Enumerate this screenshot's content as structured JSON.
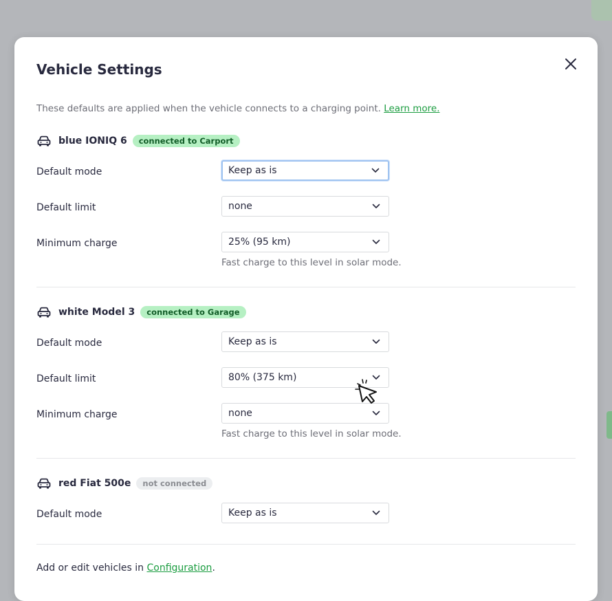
{
  "dialog": {
    "title": "Vehicle Settings",
    "intro_text": "These defaults are applied when the vehicle connects to a charging point. ",
    "intro_link": "Learn more."
  },
  "labels": {
    "default_mode": "Default mode",
    "default_limit": "Default limit",
    "minimum_charge": "Minimum charge",
    "min_charge_help": "Fast charge to this level in solar mode."
  },
  "vehicles": [
    {
      "name": "blue IONIQ 6",
      "status": "connected to Carport",
      "default_mode": "Keep as is",
      "default_limit": "none",
      "minimum_charge": "25% (95 km)"
    },
    {
      "name": "white Model 3",
      "status": "connected to Garage",
      "default_mode": "Keep as is",
      "default_limit": "80% (375 km)",
      "minimum_charge": "none"
    },
    {
      "name": "red Fiat 500e",
      "status": "not connected",
      "default_mode": "Keep as is"
    }
  ],
  "footer": {
    "text_before": "Add or edit vehicles in ",
    "link": "Configuration",
    "text_after": "."
  },
  "colors": {
    "accent": "#1a9c3f",
    "badge_connected_bg": "#b6f0c3",
    "badge_connected_text": "#125d28",
    "badge_disconnected_bg": "#eceef0",
    "focus_ring": "#9fc3f0"
  }
}
